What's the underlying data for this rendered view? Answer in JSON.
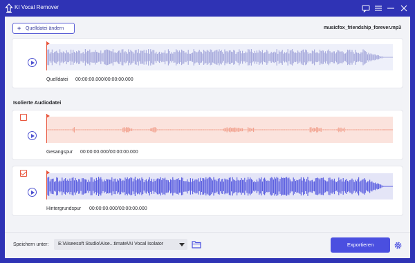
{
  "window": {
    "title": "KI Vocal Remover"
  },
  "toolbar": {
    "add_source_label": "Quelldatei ändern",
    "filename": "musicfox_friendship_forever.mp3"
  },
  "source": {
    "label": "Quelldatei",
    "time": "00:00:00.000/00:00:00.000"
  },
  "isolated": {
    "title": "Isolierte Audiodatei",
    "vocal": {
      "label": "Gesangspur",
      "time": "00:00:00.000/00:00:00.000",
      "checked": false
    },
    "background": {
      "label": "Hintergrundspur",
      "time": "00:00:00.000/00:00:00.000",
      "checked": true
    }
  },
  "footer": {
    "save_label": "Speichern unter:",
    "save_path": "E:\\Aiseesoft Studio\\Aise...timate\\AI Vocal Isolator",
    "export_label": "Exportieren"
  },
  "colors": {
    "titlebar": "#2f33b5",
    "accent": "#4a4fe0",
    "source_wave": "#a7aadc",
    "vocal_wave": "#f2a28f",
    "vocal_bg": "#fbe3dd",
    "marker": "#e8553c",
    "background_wave": "#5b5fe0",
    "background_bg": "#e4e5f7"
  }
}
